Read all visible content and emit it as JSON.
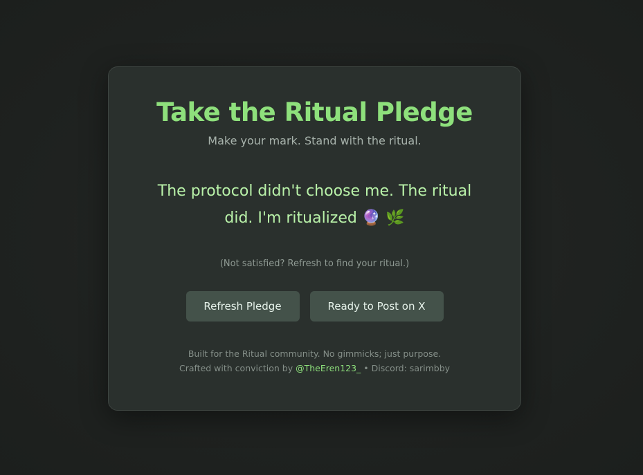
{
  "card": {
    "title": "Take the Ritual Pledge",
    "subtitle": "Make your mark. Stand with the ritual.",
    "pledge_text": "The protocol didn't choose me. The ritual did. I'm ritualized 🔮 🌿",
    "hint": "(Not satisfied? Refresh to find your ritual.)"
  },
  "buttons": {
    "refresh_label": "Refresh Pledge",
    "post_label": "Ready to Post on X"
  },
  "footer": {
    "line1": "Built for the Ritual community. No gimmicks; just purpose.",
    "crafted_prefix": "Crafted with conviction by ",
    "handle": "@TheEren123_",
    "discord_text": " • Discord: sarimbby"
  },
  "colors": {
    "background": "#1f2220",
    "card": "#2a302d",
    "accent_green": "#8ee07c",
    "pledge_green": "#b9f2a9",
    "button": "#44524a"
  }
}
